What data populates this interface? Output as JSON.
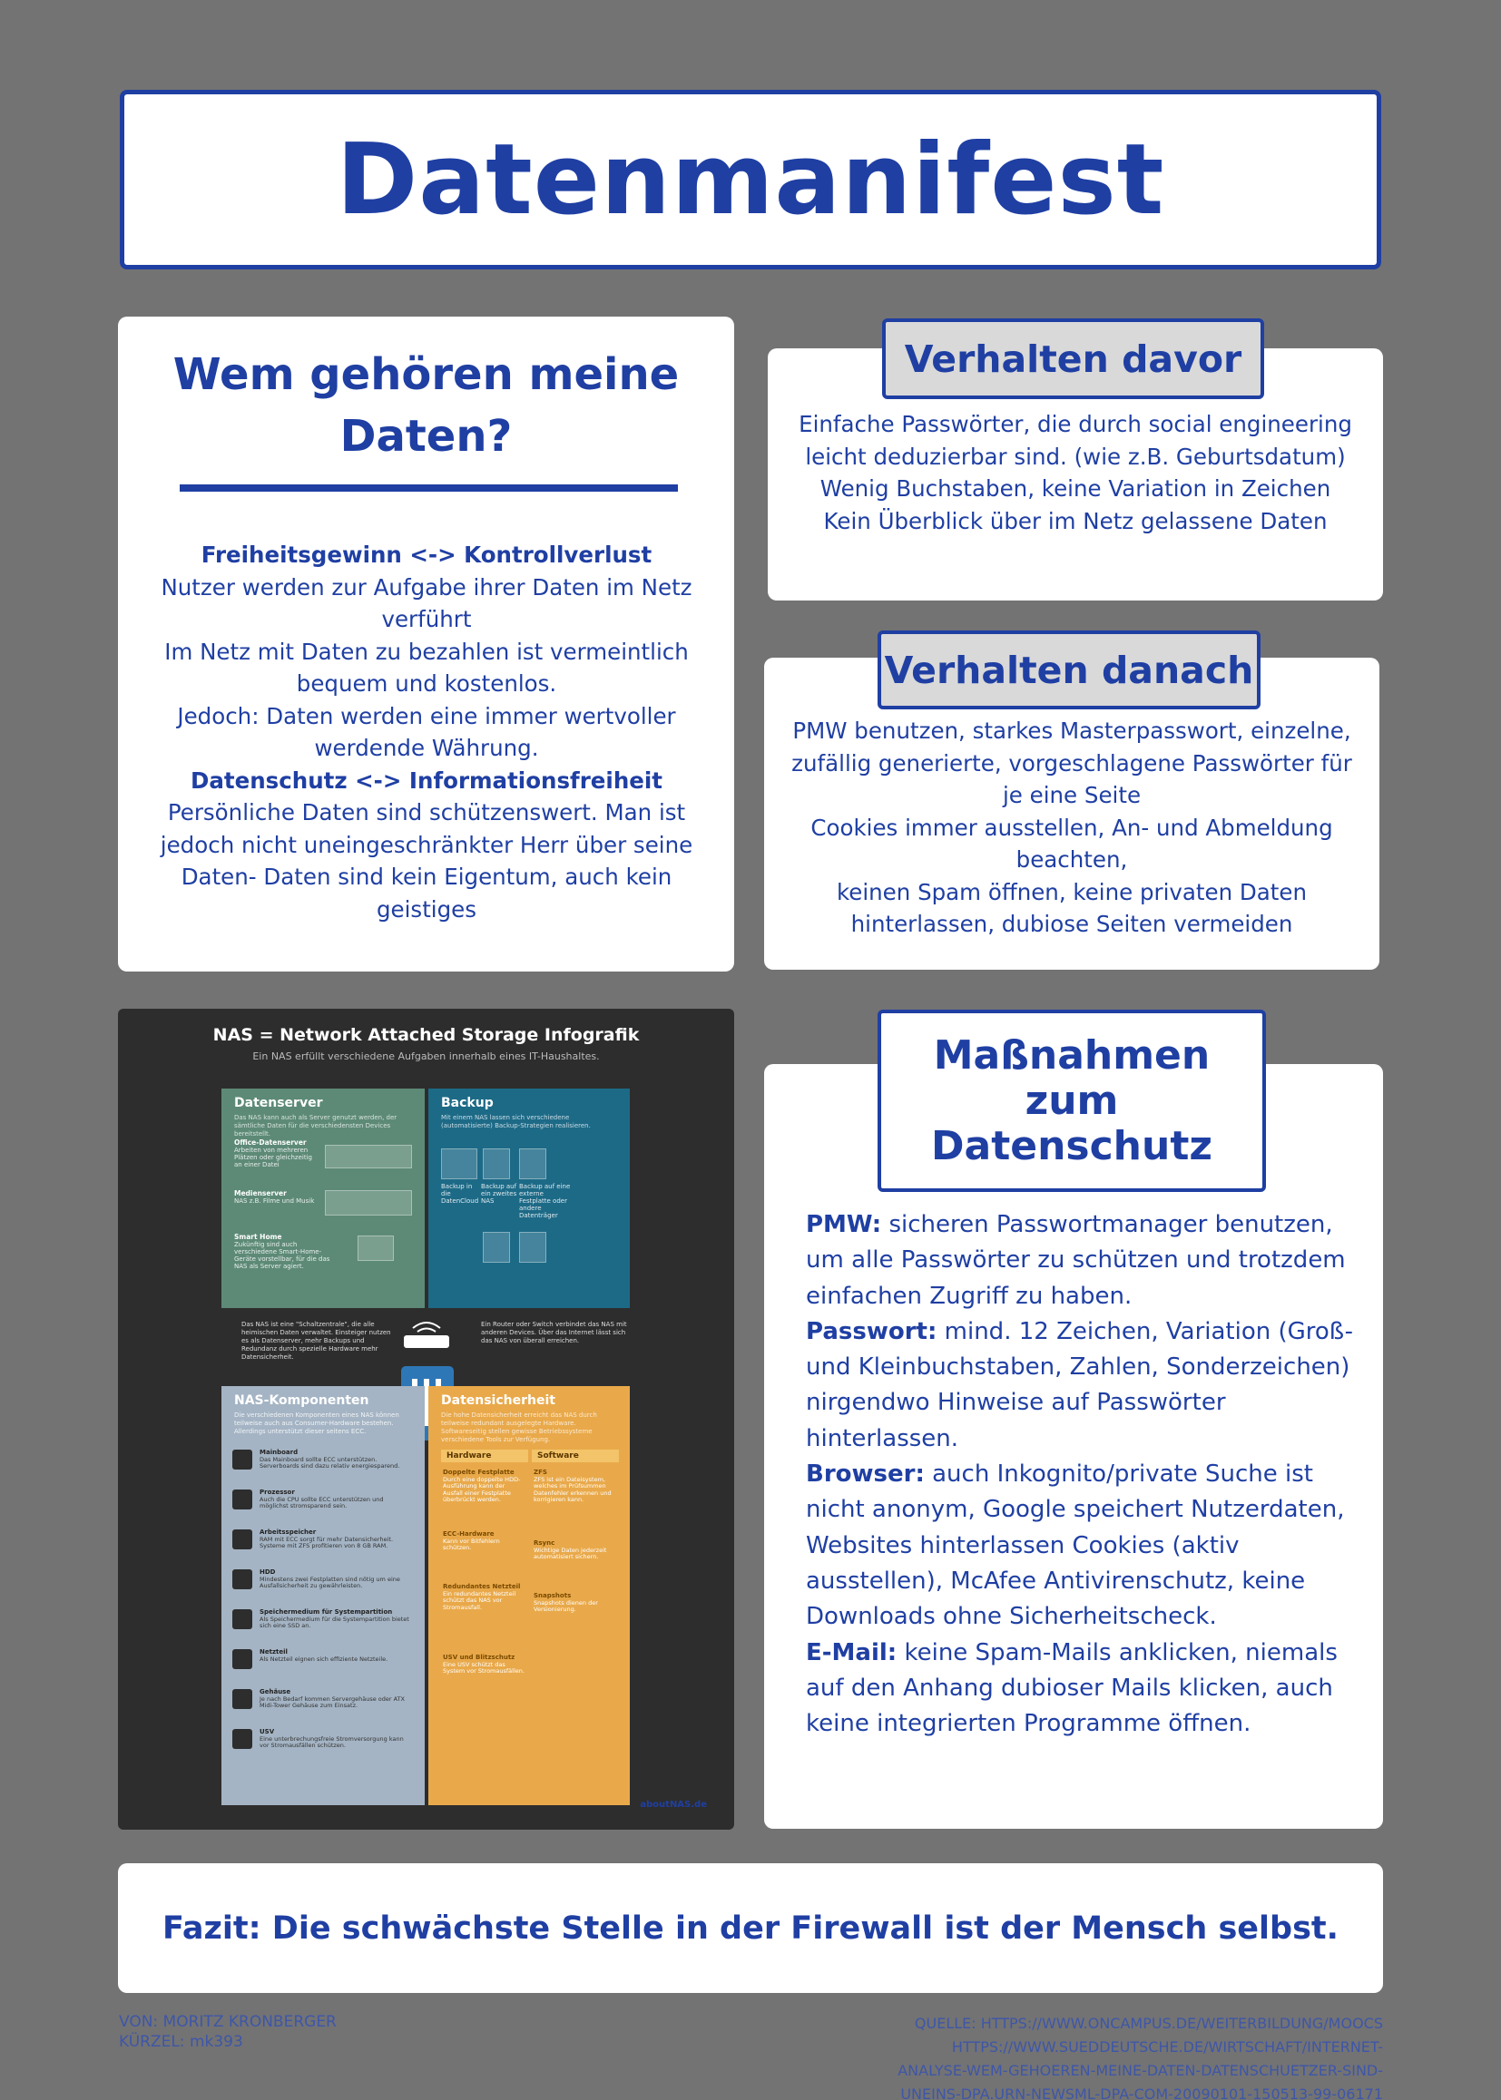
{
  "title": "Datenmanifest",
  "own_data": {
    "heading": "Wem gehören meine Daten?",
    "heading_1": "Freiheitsgewinn <-> Kontrollverlust",
    "lines_1": [
      "Nutzer werden zur Aufgabe ihrer Daten im Netz verführt",
      "Im Netz mit Daten zu bezahlen ist vermeintlich bequem und kostenlos.",
      "Jedoch: Daten werden eine immer wertvoller werdende Währung."
    ],
    "heading_2": "Datenschutz <-> Informationsfreiheit",
    "lines_2": [
      "Persönliche Daten sind schützenswert. Man ist jedoch nicht uneingeschränkter Herr über seine Daten- Daten sind kein Eigentum, auch kein geistiges"
    ]
  },
  "before": {
    "tag": "Verhalten davor",
    "lines": [
      "Einfache Passwörter, die durch social engineering leicht deduzierbar sind. (wie z.B. Geburtsdatum)",
      "Wenig Buchstaben, keine Variation in Zeichen",
      "Kein Überblick über im Netz gelassene Daten"
    ]
  },
  "after": {
    "tag": "Verhalten danach",
    "lines": [
      "PMW benutzen, starkes Masterpasswort, einzelne, zufällig generierte, vorgeschlagene Passwörter für je eine Seite",
      "Cookies immer ausstellen, An- und Abmeldung beachten,",
      "keinen Spam öffnen, keine privaten Daten hinterlassen, dubiose Seiten vermeiden"
    ]
  },
  "measures": {
    "tag": "Maßnahmen zum Datenschutz",
    "items": [
      {
        "label": "PMW:",
        "text": " sicheren Passwortmanager benutzen, um alle Passwörter zu schützen und trotzdem einfachen Zugriff zu haben."
      },
      {
        "label": "Passwort:",
        "text": " mind. 12 Zeichen, Variation (Groß- und Kleinbuchstaben, Zahlen, Sonderzeichen) nirgendwo Hinweise auf Passwörter hinterlassen."
      },
      {
        "label": "Browser:",
        "text": " auch Inkognito/private Suche ist nicht anonym, Google speichert Nutzerdaten, Websites hinterlassen Cookies (aktiv ausstellen), McAfee Antivirenschutz, keine Downloads ohne Sicherheitscheck."
      },
      {
        "label": "E-Mail:",
        "text": " keine Spam-Mails anklicken, niemals auf den Anhang dubioser Mails klicken, auch keine integrierten Programme öffnen."
      }
    ]
  },
  "infographic": {
    "title": "NAS = Network Attached Storage Infografik",
    "subtitle": "Ein NAS erfüllt verschiedene Aufgaben innerhalb eines IT-Haushaltes.",
    "panel_server": "Datenserver",
    "server_text": "Das NAS kann auch als Server genutzt werden, der sämtliche Daten für die verschiedensten Devices bereitstellt.",
    "server_items": [
      {
        "title": "Office-Datenserver",
        "text": "Arbeiten von mehreren Plätzen oder gleichzeitig an einer Datei"
      },
      {
        "title": "Medienserver",
        "text": "NAS z.B. Filme und Musik"
      },
      {
        "title": "Smart Home",
        "text": "Zukünftig sind auch verschiedene Smart-Home-Geräte vorstellbar, für die das NAS als Server agiert."
      }
    ],
    "panel_backup": "Backup",
    "backup_text": "Mit einem NAS lassen sich verschiedene (automatisierte) Backup-Strategien realisieren.",
    "backup_items": [
      "Backup in die DatenCloud",
      "Backup auf ein zweites NAS",
      "Backup auf eine externe Festplatte oder andere Datenträger"
    ],
    "mid_left": "Das NAS ist eine \"Schaltzentrale\", die alle heimischen Daten verwaltet. Einsteiger nutzen es als Datenserver, mehr Backups und Redundanz durch spezielle Hardware mehr Datensicherheit.",
    "mid_right": "Ein Router oder Switch verbindet das NAS mit anderen Devices. Über das Internet lässt sich das NAS von überall erreichen.",
    "panel_components": "NAS-Komponenten",
    "components_text": "Die verschiedenen Komponenten eines NAS können teilweise auch aus Consumer-Hardware bestehen. Allerdings unterstützt dieser seitens ECC.",
    "components": [
      {
        "title": "Mainboard",
        "text": "Das Mainboard sollte ECC unterstützen. Serverboards sind dazu relativ energiesparend."
      },
      {
        "title": "Prozessor",
        "text": "Auch die CPU sollte ECC unterstützen und möglichst stromsparend sein."
      },
      {
        "title": "Arbeitsspeicher",
        "text": "RAM mit ECC sorgt für mehr Datensicherheit. Systeme mit ZFS profitieren von 8 GB RAM."
      },
      {
        "title": "HDD",
        "text": "Mindestens zwei Festplatten sind nötig um eine Ausfallsicherheit zu gewährleisten."
      },
      {
        "title": "Speichermedium für Systempartition",
        "text": "Als Speichermedium für die Systempartition bietet sich eine SSD an."
      },
      {
        "title": "Netzteil",
        "text": "Als Netzteil eignen sich effiziente Netzteile."
      },
      {
        "title": "Gehäuse",
        "text": "Je nach Bedarf kommen Servergehäuse oder ATX Midi-Tower Gehäuse zum Einsatz."
      },
      {
        "title": "USV",
        "text": "Eine unterbrechungsfreie Stromversorgung kann vor Stromausfällen schützen."
      }
    ],
    "panel_security": "Datensicherheit",
    "security_text": "Die hohe Datensicherheit erreicht das NAS durch teilweise redundant ausgelegte Hardware. Softwareseitig stellen gewisse Betriebssysteme verschiedene Tools zur Verfügung.",
    "col_hardware": "Hardware",
    "col_software": "Software",
    "hardware_items": [
      {
        "title": "Doppelte Festplatte",
        "text": "Durch eine doppelte HDD-Ausführung kann der Ausfall einer Festplatte überbrückt werden."
      },
      {
        "title": "ECC-Hardware",
        "text": "Kann vor Bitfehlern schützen."
      },
      {
        "title": "Redundantes Netzteil",
        "text": "Ein redundantes Netzteil schützt das NAS vor Stromausfall."
      },
      {
        "title": "USV und Blitzschutz",
        "text": "Eine USV schützt das System vor Stromausfällen."
      }
    ],
    "software_items": [
      {
        "title": "ZFS",
        "text": "ZFS ist ein Dateisystem, welches im Prüfsummen Datenfehler erkennen und korrigieren kann."
      },
      {
        "title": "Rsync",
        "text": "Wichtige Daten jederzeit automatisiert sichern."
      },
      {
        "title": "Snapshots",
        "text": "Snapshots dienen der Versionierung."
      }
    ],
    "brand": "aboutNAS.de"
  },
  "conclusion": "Fazit: Die schwächste Stelle in der Firewall ist der Mensch selbst.",
  "footer": {
    "author": "VON: MORITZ KRONBERGER",
    "kuerzel_label": "KÜRZEL: ",
    "kuerzel": "mk393",
    "source_lines": [
      "QUELLE: HTTPS://WWW.ONCAMPUS.DE/WEITERBILDUNG/MOOCS",
      "HTTPS://WWW.SUEDDEUTSCHE.DE/WIRTSCHAFT/INTERNET-",
      "ANALYSE-WEM-GEHOEREN-MEINE-DATEN-DATENSCHUETZER-SIND-",
      "UNEINS-DPA.URN-NEWSML-DPA-COM-20090101-150513-99-06171"
    ]
  }
}
